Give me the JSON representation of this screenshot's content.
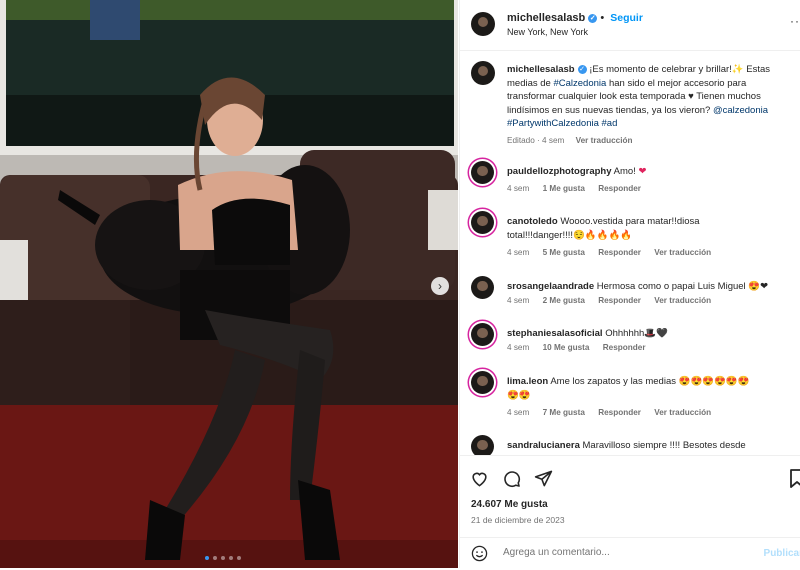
{
  "header": {
    "username": "michellesalasb",
    "follow_label": "Seguir",
    "location": "New York, New York"
  },
  "caption": {
    "username": "michellesalasb",
    "text_1": "¡Es momento de celebrar y brillar!✨ Estas medias de ",
    "tag_calzedonia": "#Calzedonia",
    "text_2": " han sido el mejor accesorio para transformar cualquier look esta temporada ♥ Tienen muchos lindísimos en sus nuevas tiendas, ya los vieron? ",
    "mention": "@calzedonia",
    "hashtags": "#PartywithCalzedonia #ad",
    "edited": "Editado · 4 sem",
    "see_translation": "Ver traducción"
  },
  "comments": [
    {
      "username": "pauldellozphotography",
      "text": "Amo! ",
      "emoji": "❤",
      "time": "4 sem",
      "likes": "1 Me gusta",
      "reply": "Responder",
      "translate": ""
    },
    {
      "username": "canotoledo",
      "text": "Woooo.vestida para matar!!diosa total!!!danger!!!!😌🔥🔥🔥🔥",
      "emoji": "",
      "time": "4 sem",
      "likes": "5 Me gusta",
      "reply": "Responder",
      "translate": "Ver traducción"
    },
    {
      "username": "srosangelaandrade",
      "text": "Hermosa como o papai Luis Miguel ",
      "emoji": "😍❤",
      "time": "4 sem",
      "likes": "2 Me gusta",
      "reply": "Responder",
      "translate": "Ver traducción"
    },
    {
      "username": "stephaniesalasoficial",
      "text": "Ohhhhhh🎩🖤",
      "emoji": "",
      "time": "4 sem",
      "likes": "10 Me gusta",
      "reply": "Responder",
      "translate": ""
    },
    {
      "username": "lima.leon",
      "text": "Ame los zapatos y las medias 😍😍😍😍😍😍😍😍",
      "emoji": "",
      "time": "4 sem",
      "likes": "7 Me gusta",
      "reply": "Responder",
      "translate": "Ver traducción"
    },
    {
      "username": "sandralucianera",
      "text": "Maravilloso siempre !!!! Besotes desde",
      "emoji": "",
      "time": "",
      "likes": "",
      "reply": "",
      "translate": ""
    }
  ],
  "actions": {
    "likes": "24.607 Me gusta",
    "date": "21 de diciembre de 2023",
    "comment_placeholder": "Agrega un comentario...",
    "publish": "Publicar"
  },
  "photo": {
    "slide_current": 1,
    "slide_count": 5
  },
  "colors": {
    "link": "#00376b",
    "follow": "#0095f6",
    "heart": "#e0245e",
    "story_ring": "#d6249f"
  },
  "icons": [
    "heart-icon",
    "comment-icon",
    "share-icon",
    "bookmark-icon",
    "emoji-icon",
    "more-icon",
    "chevron-right-icon",
    "verified-icon"
  ]
}
